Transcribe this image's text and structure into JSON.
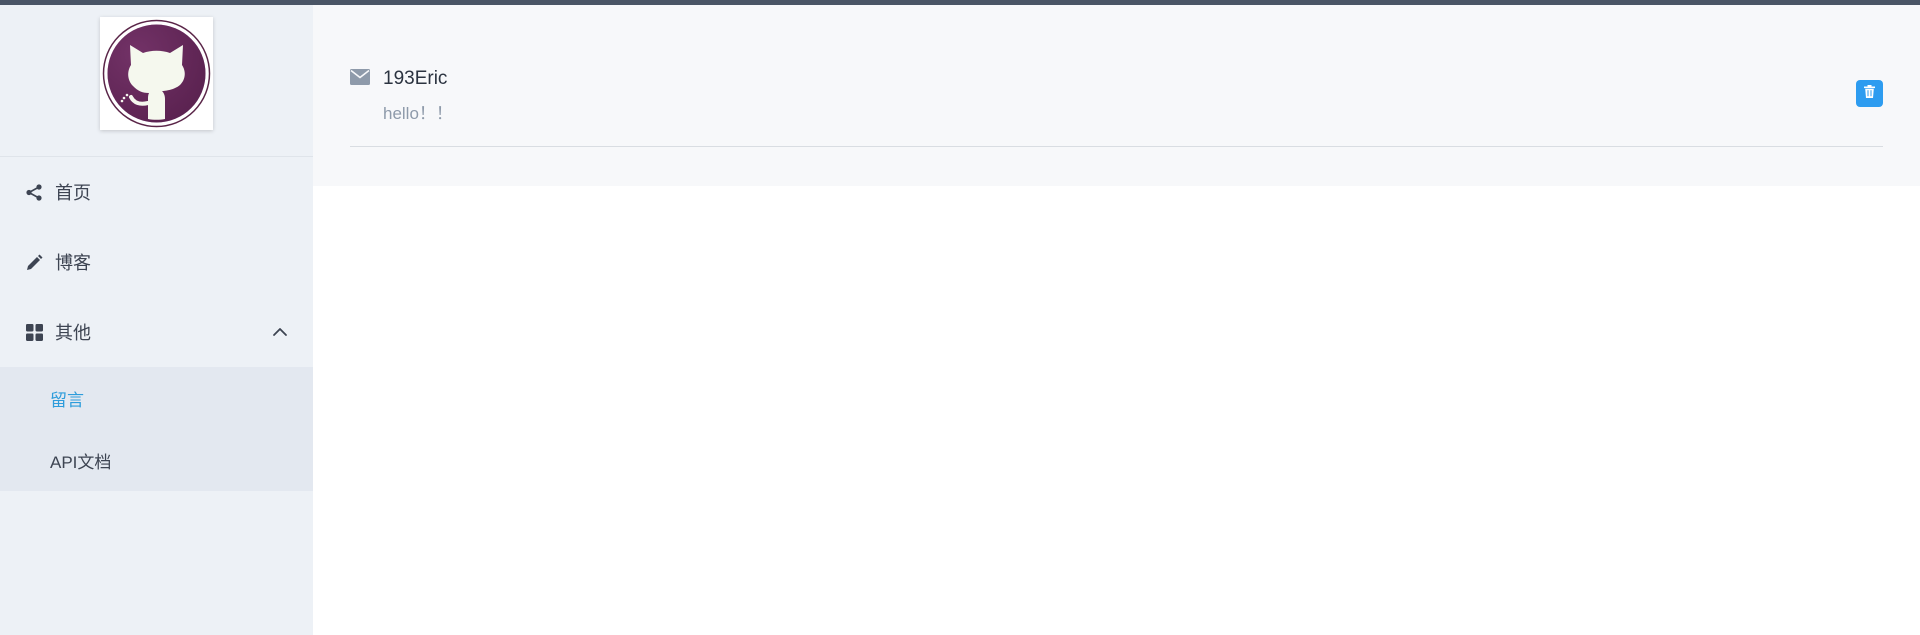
{
  "sidebar": {
    "logo_icon": "github-octocat-icon",
    "menu": [
      {
        "label": "首页",
        "icon": "share-icon"
      },
      {
        "label": "博客",
        "icon": "pencil-icon"
      },
      {
        "label": "其他",
        "icon": "grid-icon",
        "expanded": true
      }
    ],
    "submenu": [
      {
        "label": "留言",
        "active": true
      },
      {
        "label": "API文档",
        "active": false
      }
    ]
  },
  "messages": [
    {
      "name": "193Eric",
      "text": "hello！！",
      "icon": "envelope-icon",
      "action_icon": "trash-icon"
    }
  ],
  "colors": {
    "accent": "#2d9cdb",
    "delete_button": "#2d9cf0",
    "sidebar_bg": "#edf1f6",
    "submenu_bg": "#e3e8f0",
    "topbar": "#4a5566"
  }
}
